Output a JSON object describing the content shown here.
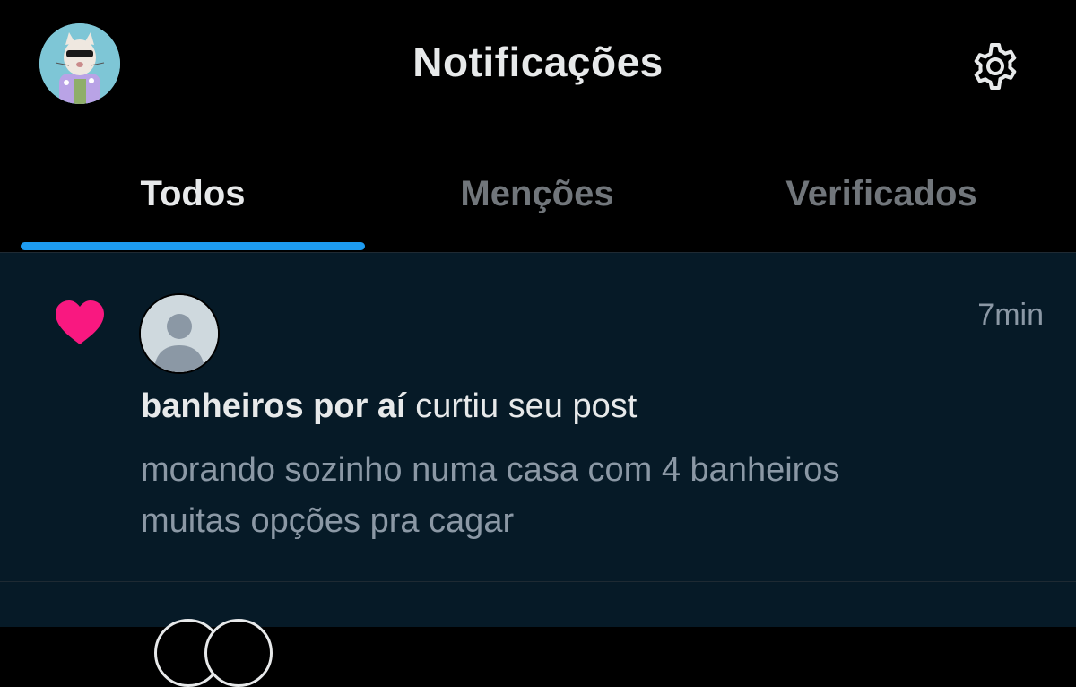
{
  "header": {
    "title": "Notificações",
    "avatar_icon": "cat-avatar-icon",
    "settings_icon": "gear-icon"
  },
  "tabs": [
    {
      "label": "Todos",
      "active": true
    },
    {
      "label": "Menções",
      "active": false
    },
    {
      "label": "Verificados",
      "active": false
    }
  ],
  "notification": {
    "type_icon": "heart-icon",
    "actor_name": "banheiros por aí",
    "action": "curtiu seu post",
    "time": "7min",
    "post_line1": "morando sozinho numa casa com 4 banheiros",
    "post_line2": "muitas opções pra cagar"
  },
  "colors": {
    "accent": "#1d9bf0",
    "heart": "#f91880",
    "background": "#000000",
    "unread_background": "#061a27"
  }
}
